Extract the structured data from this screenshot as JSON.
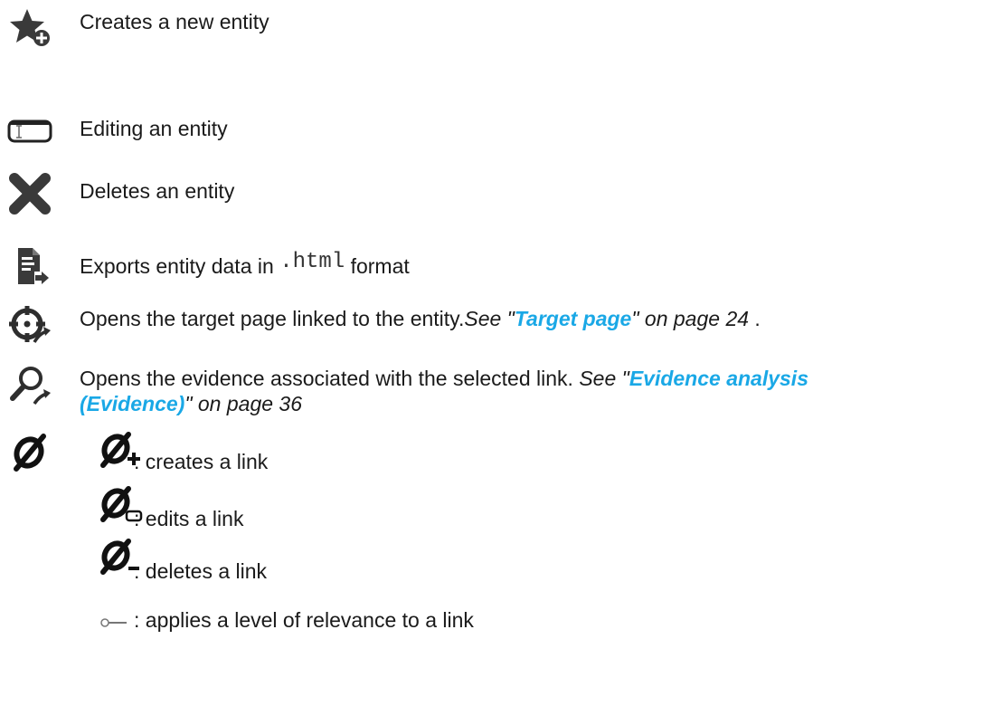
{
  "rows": [
    {
      "icon": "star-plus-icon",
      "text": "Creates a new entity"
    },
    {
      "icon": "text-field-icon",
      "text": "Editing an entity"
    },
    {
      "icon": "cross-icon",
      "text": "Deletes an entity"
    },
    {
      "icon": "export-document-icon",
      "text_before": "Exports entity data in ",
      "code": ".html",
      "text_after": " format"
    },
    {
      "icon": "target-open-icon",
      "text": "Opens the target page linked to the entity.",
      "ref_prefix": "See \"",
      "ref_link": "Target page",
      "ref_suffix": "\" on page 24",
      "tail": " ."
    },
    {
      "icon": "magnifier-open-icon",
      "text": "Opens the evidence associated with the selected link. ",
      "ref_prefix": "See \"",
      "ref_link_line1": "Evidence analysis",
      "ref_link_line2": "(Evidence)",
      "ref_suffix": "\" on page 36"
    },
    {
      "icon": "link-icon"
    }
  ],
  "link_items": [
    {
      "icon": "link-plus-icon",
      "text": ": creates a link"
    },
    {
      "icon": "link-edit-icon",
      "text": ": edits a link"
    },
    {
      "icon": "link-minus-icon",
      "text": ": deletes a link"
    },
    {
      "icon": "relevance-slider-icon",
      "text": " : applies a level of relevance to a link"
    }
  ]
}
